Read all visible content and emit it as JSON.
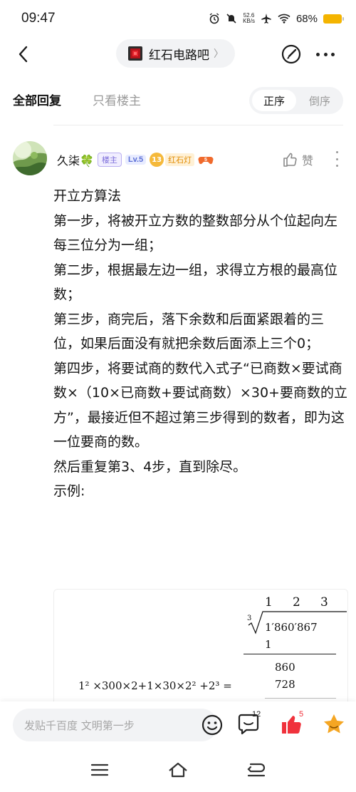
{
  "status": {
    "time": "09:47",
    "speed_value": "52.6",
    "speed_unit": "KB/s",
    "battery": "68%"
  },
  "nav": {
    "forum_name": "红石电路吧",
    "chevron": "〉"
  },
  "filter": {
    "all_replies": "全部回复",
    "only_op": "只看楼主",
    "sort_asc": "正序",
    "sort_desc": "倒序"
  },
  "post": {
    "username": "久柒🍀",
    "badge_owner": "楼主",
    "level": "Lv.5",
    "title_level": "13",
    "title_name": "红石灯",
    "like_label": "赞",
    "lines": [
      "开立方算法",
      "第一步，将被开立方数的整数部分从个位起向左每三位分为一组；",
      "第二步，根据最左边一组，求得立方根的最高位数；",
      "第三步，商完后，落下余数和后面紧跟着的三位，如果后面没有就把余数后面添上三个0；",
      "第四步，将要试商的数代入式子“已商数×要试商数×（10×已商数+要试商数）×30+要商数的立方”，最接近但不超过第三步得到的数者，即为这一位要商的数。",
      "然后重复第3、4步，直到除尽。",
      "示例:"
    ]
  },
  "example": {
    "quotient": [
      "1",
      "2",
      "3"
    ],
    "index": "3",
    "radicand": "1′860′867",
    "first_sub": "1",
    "remainder": "860",
    "formula": "1² ×300×2+1×30×2² +2³  =",
    "result": "728"
  },
  "actions": {
    "reply_placeholder": "发贴千百度 文明第一步",
    "comments_count": "12",
    "likes_count": "5"
  },
  "colors": {
    "accent_red": "#f0323c",
    "star_orange": "#f5a623",
    "owner_badge": "#7b6cd9"
  }
}
